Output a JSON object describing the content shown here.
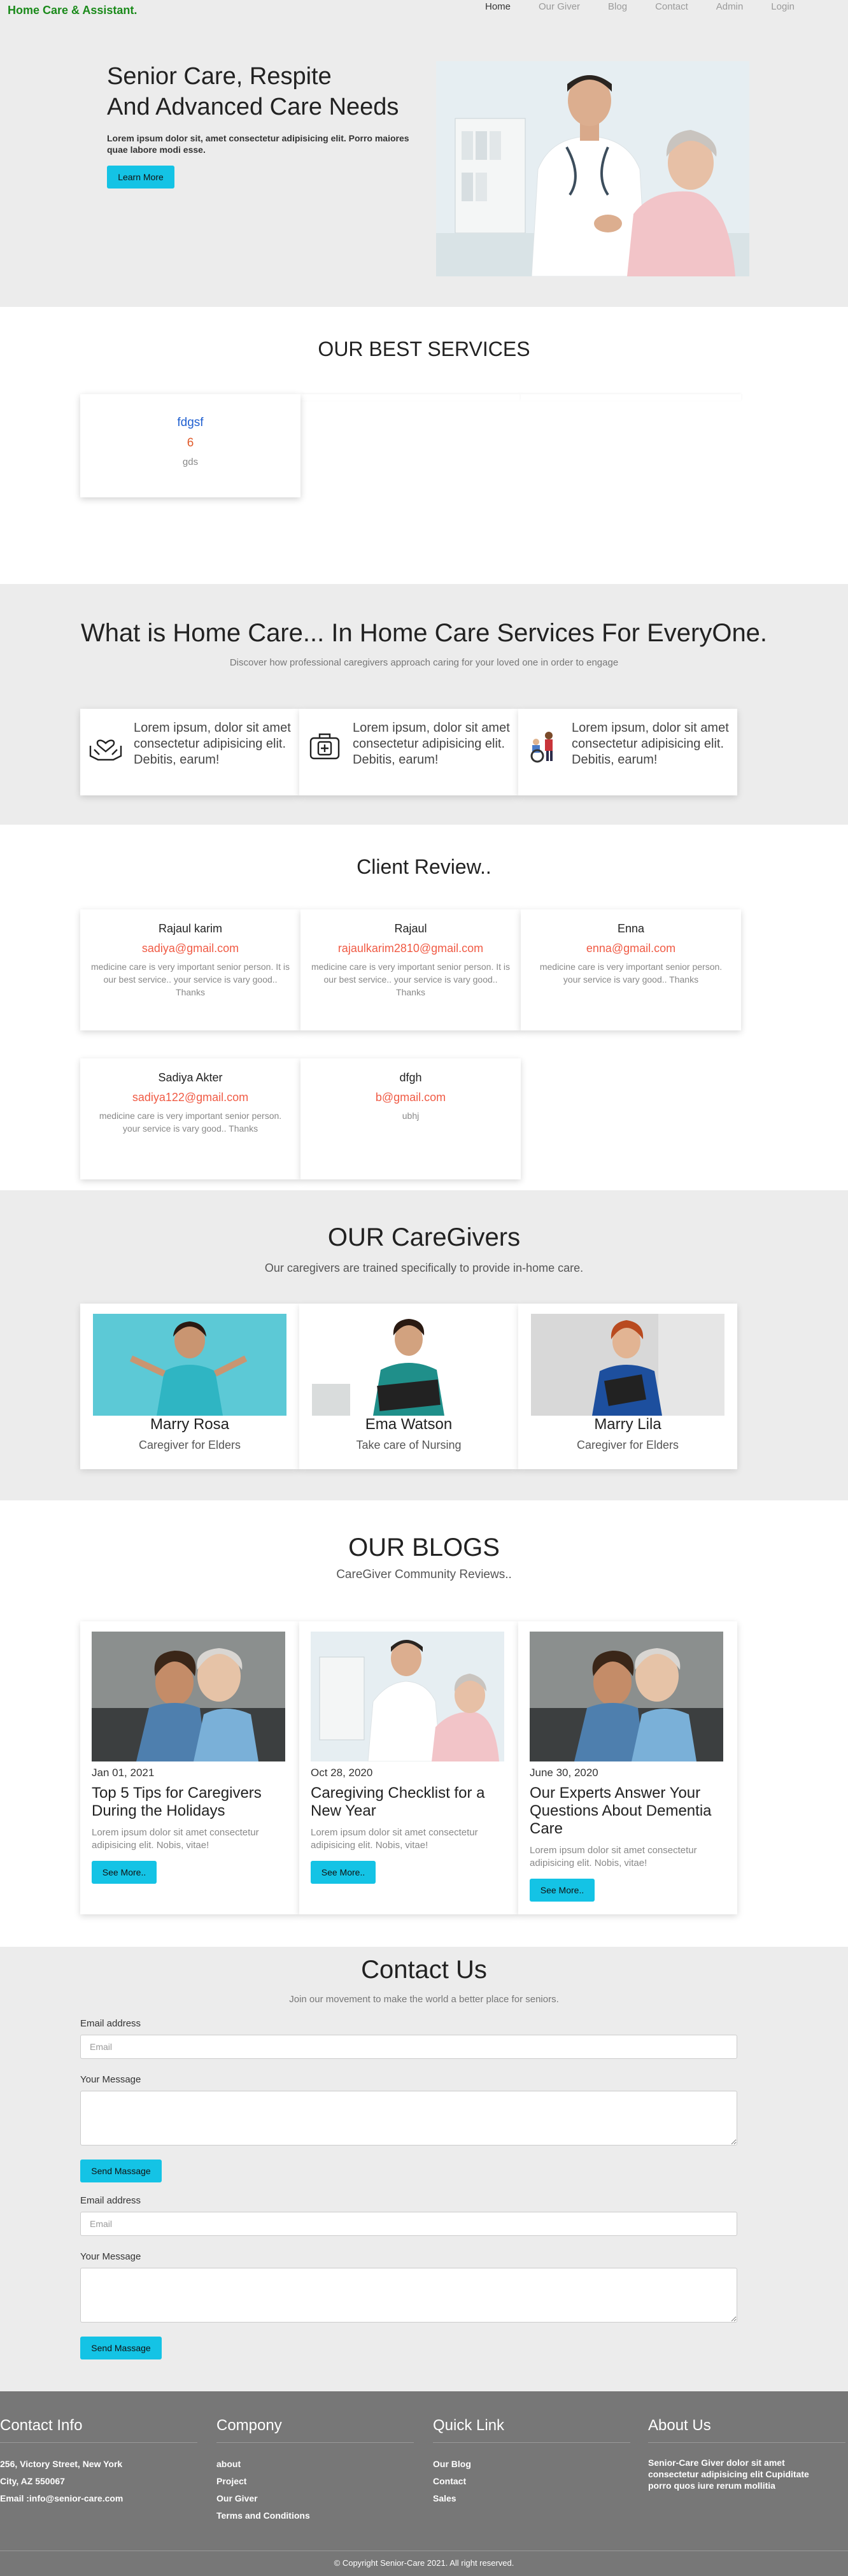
{
  "nav": {
    "brand": "Home Care & Assistant.",
    "links": [
      "Home",
      "Our Giver",
      "Blog",
      "Contact",
      "Admin",
      "Login"
    ]
  },
  "hero": {
    "title_line1": "Senior Care, Respite",
    "title_line2": "And Advanced Care Needs",
    "text": "Lorem ipsum dolor sit, amet consectetur adipisicing elit. Porro maiores quae labore modi esse.",
    "button": "Learn More"
  },
  "services": {
    "title": "OUR BEST SERVICES",
    "cards": [
      {
        "name": "fdgsf",
        "price": "6",
        "desc": "gds"
      }
    ]
  },
  "whatis": {
    "title": "What is Home Care... In Home Care Services For EveryOne.",
    "subtitle": "Discover how professional caregivers approach caring for your loved one in order to engage",
    "features": [
      {
        "icon": "heart-hands-icon",
        "text": "Lorem ipsum, dolor sit amet consectetur adipisicing elit. Debitis, earum!"
      },
      {
        "icon": "medical-kit-icon",
        "text": "Lorem ipsum, dolor sit amet consectetur adipisicing elit. Debitis, earum!"
      },
      {
        "icon": "wheelchair-care-icon",
        "text": "Lorem ipsum, dolor sit amet consectetur adipisicing elit. Debitis, earum!"
      }
    ]
  },
  "reviews": {
    "title": "Client Review..",
    "items": [
      {
        "name": "Rajaul karim",
        "email": "sadiya@gmail.com",
        "text": "medicine care is very important senior person. It is our best service.. your service is vary good.. Thanks"
      },
      {
        "name": "Rajaul",
        "email": "rajaulkarim2810@gmail.com",
        "text": "medicine care is very important senior person. It is our best service.. your service is vary good.. Thanks"
      },
      {
        "name": "Enna",
        "email": "enna@gmail.com",
        "text": "medicine care is very important senior person. your service is vary good.. Thanks"
      },
      {
        "name": "Sadiya Akter",
        "email": "sadiya122@gmail.com",
        "text": "medicine care is very important senior person. your service is vary good.. Thanks"
      },
      {
        "name": "dfgh",
        "email": "b@gmail.com",
        "text": "ubhj"
      }
    ]
  },
  "caregivers": {
    "title": "OUR CareGivers",
    "subtitle": "Our caregivers are trained specifically to provide in-home care.",
    "items": [
      {
        "name": "Marry Rosa",
        "role": "Caregiver for Elders"
      },
      {
        "name": "Ema Watson",
        "role": "Take care of Nursing"
      },
      {
        "name": "Marry Lila",
        "role": "Caregiver for Elders"
      }
    ]
  },
  "blogs": {
    "title": "OUR BLOGS",
    "subtitle": "CareGiver Community Reviews..",
    "items": [
      {
        "date": "Jan 01, 2021",
        "title": "Top 5 Tips for Caregivers During the Holidays",
        "text": "Lorem ipsum dolor sit amet consectetur adipisicing elit. Nobis, vitae!",
        "button": "See More.."
      },
      {
        "date": "Oct 28, 2020",
        "title": "Caregiving Checklist for a New Year",
        "text": "Lorem ipsum dolor sit amet consectetur adipisicing elit. Nobis, vitae!",
        "button": "See More.."
      },
      {
        "date": "June 30, 2020",
        "title": "Our Experts Answer Your Questions About Dementia Care",
        "text": "Lorem ipsum dolor sit amet consectetur adipisicing elit. Nobis, vitae!",
        "button": "See More.."
      }
    ]
  },
  "contact": {
    "title": "Contact Us",
    "subtitle": "Join our movement to make the world a better place for seniors.",
    "email_label": "Email address",
    "email_placeholder": "Email",
    "message_label": "Your Message",
    "button": "Send Massage"
  },
  "footer": {
    "contact": {
      "title": "Contact Info",
      "lines": [
        "256, Victory Street, New York",
        "City, AZ 550067",
        "Email :info@senior-care.com"
      ]
    },
    "company": {
      "title": "Compony",
      "links": [
        "about",
        "Project",
        "Our Giver",
        "Terms and Conditions"
      ]
    },
    "quick": {
      "title": "Quick Link",
      "links": [
        "Our Blog",
        "Contact",
        "Sales"
      ]
    },
    "about": {
      "title": "About Us",
      "text": "Senior-Care Giver dolor sit amet consectetur adipisicing elit Cupiditate porro quos iure rerum mollitia"
    },
    "copyright": "© Copyright Senior-Care 2021. All right reserved."
  },
  "colors": {
    "brand": "#1a8a1a",
    "accent": "#14c3e5",
    "email": "#f05a44",
    "footer": "#777777"
  }
}
